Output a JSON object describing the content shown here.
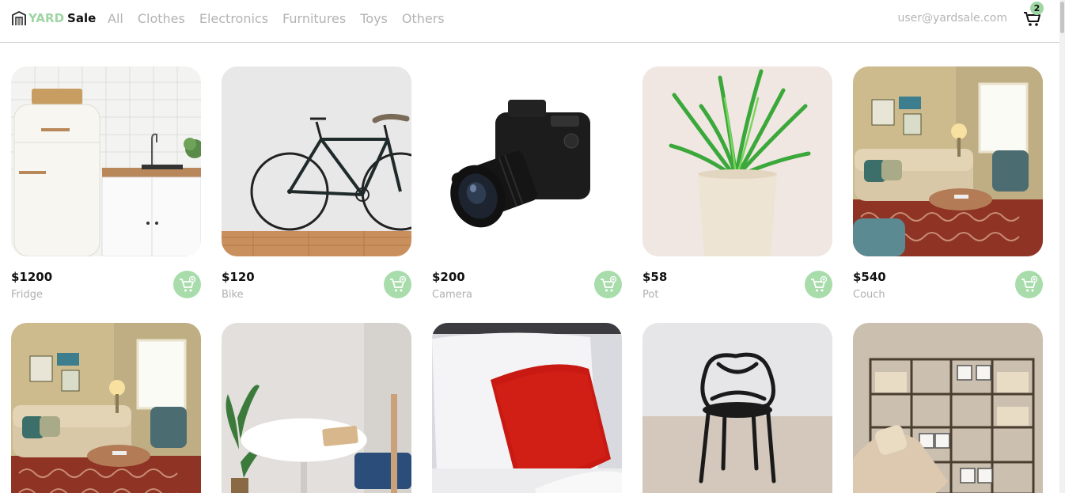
{
  "header": {
    "logo_yard": "YARD",
    "logo_sale": "Sale",
    "nav": [
      "All",
      "Clothes",
      "Electronics",
      "Furnitures",
      "Toys",
      "Others"
    ],
    "user_email": "user@yardsale.com",
    "cart_count": "2"
  },
  "colors": {
    "accent": "#9fd6a3",
    "muted_text": "#b3b3b3",
    "price_text": "#111111"
  },
  "products": [
    {
      "price": "$1200",
      "name": "Fridge",
      "image": "fridge-image"
    },
    {
      "price": "$120",
      "name": "Bike",
      "image": "bike-image"
    },
    {
      "price": "$200",
      "name": "Camera",
      "image": "camera-image"
    },
    {
      "price": "$58",
      "name": "Pot",
      "image": "pot-image"
    },
    {
      "price": "$540",
      "name": "Couch",
      "image": "couch-image"
    },
    {
      "price": "",
      "name": "",
      "image": "couch-image"
    },
    {
      "price": "",
      "name": "",
      "image": "table-image"
    },
    {
      "price": "",
      "name": "",
      "image": "pillow-image"
    },
    {
      "price": "",
      "name": "",
      "image": "chair-image"
    },
    {
      "price": "",
      "name": "",
      "image": "shelf-image"
    }
  ]
}
